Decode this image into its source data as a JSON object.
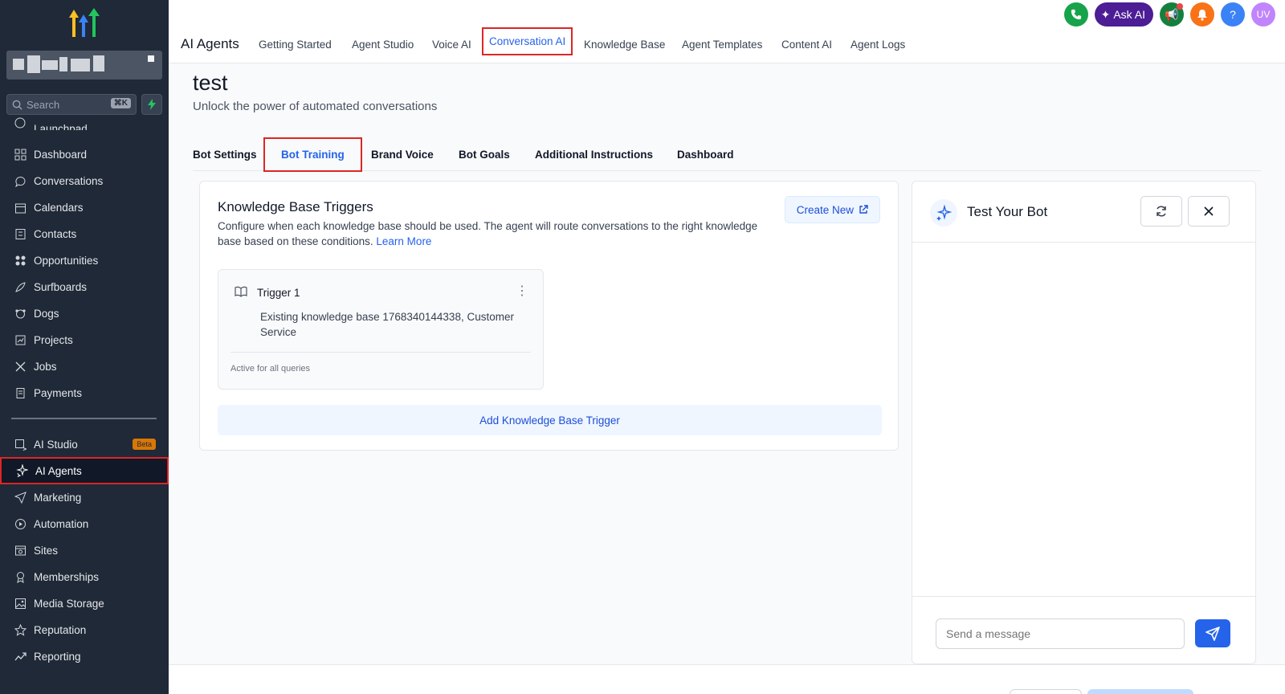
{
  "sidebar": {
    "search_placeholder": "Search",
    "search_shortcut": "⌘K",
    "partial_item": "Launchpad",
    "items": [
      {
        "label": "Dashboard",
        "icon": "dashboard-icon"
      },
      {
        "label": "Conversations",
        "icon": "chat-icon"
      },
      {
        "label": "Calendars",
        "icon": "calendar-icon"
      },
      {
        "label": "Contacts",
        "icon": "contacts-icon"
      },
      {
        "label": "Opportunities",
        "icon": "opportunities-icon"
      },
      {
        "label": "Surfboards",
        "icon": "surfboard-icon"
      },
      {
        "label": "Dogs",
        "icon": "dog-icon"
      },
      {
        "label": "Projects",
        "icon": "projects-icon"
      },
      {
        "label": "Jobs",
        "icon": "jobs-icon"
      },
      {
        "label": "Payments",
        "icon": "payments-icon"
      }
    ],
    "items2": [
      {
        "label": "AI Studio",
        "icon": "ai-studio-icon",
        "badge": "Beta"
      },
      {
        "label": "AI Agents",
        "icon": "sparkles-icon",
        "active": true
      },
      {
        "label": "Marketing",
        "icon": "send-icon"
      },
      {
        "label": "Automation",
        "icon": "automation-icon"
      },
      {
        "label": "Sites",
        "icon": "sites-icon"
      },
      {
        "label": "Memberships",
        "icon": "memberships-icon"
      },
      {
        "label": "Media Storage",
        "icon": "image-icon"
      },
      {
        "label": "Reputation",
        "icon": "star-icon"
      },
      {
        "label": "Reporting",
        "icon": "trend-icon"
      }
    ]
  },
  "topbar": {
    "title": "AI Agents",
    "tabs": [
      "Getting Started",
      "Agent Studio",
      "Voice AI",
      "Conversation AI",
      "Knowledge Base",
      "Agent Templates",
      "Content AI",
      "Agent Logs"
    ],
    "active_tab": "Conversation AI",
    "ask_ai": "Ask AI",
    "help": "?",
    "avatar_initials": "UV"
  },
  "page": {
    "title": "test",
    "subtitle": "Unlock the power of automated conversations",
    "tabs": [
      "Bot Settings",
      "Bot Training",
      "Brand Voice",
      "Bot Goals",
      "Additional Instructions",
      "Dashboard"
    ],
    "active_tab": "Bot Training"
  },
  "kb": {
    "title": "Knowledge Base Triggers",
    "description": "Configure when each knowledge base should be used. The agent will route conversations to the right knowledge base based on these conditions.",
    "learn_more": "Learn More",
    "create_new": "Create New",
    "trigger": {
      "name": "Trigger 1",
      "description": "Existing knowledge base 1768340144338, Customer Service",
      "footer": "Active for all queries"
    },
    "add_trigger": "Add Knowledge Base Trigger"
  },
  "bot": {
    "title": "Test Your Bot",
    "message_placeholder": "Send a message"
  },
  "colors": {
    "sidebar_bg": "#1f2937",
    "accent": "#2563eb",
    "highlight_border": "#dc2626"
  }
}
